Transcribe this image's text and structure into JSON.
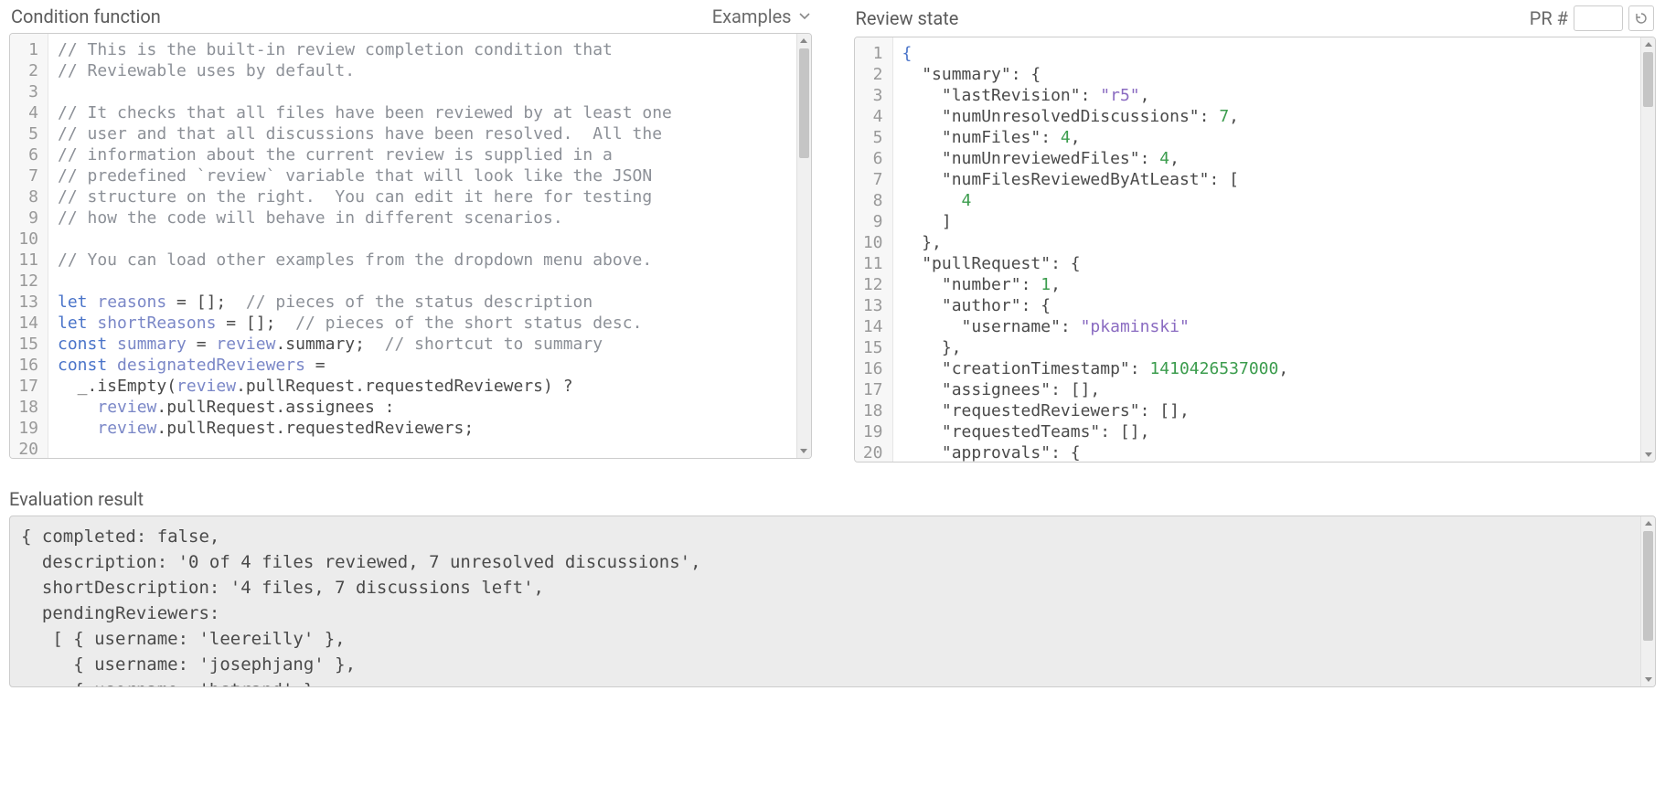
{
  "left": {
    "title": "Condition function",
    "examples_label": "Examples",
    "code_lines": [
      {
        "n": "1",
        "t": "comment",
        "text": "// This is the built-in review completion condition that"
      },
      {
        "n": "2",
        "t": "comment",
        "text": "// Reviewable uses by default."
      },
      {
        "n": "3",
        "t": "blank",
        "text": ""
      },
      {
        "n": "4",
        "t": "comment",
        "text": "// It checks that all files have been reviewed by at least one"
      },
      {
        "n": "5",
        "t": "comment",
        "text": "// user and that all discussions have been resolved.  All the"
      },
      {
        "n": "6",
        "t": "comment",
        "text": "// information about the current review is supplied in a"
      },
      {
        "n": "7",
        "t": "comment",
        "text": "// predefined `review` variable that will look like the JSON"
      },
      {
        "n": "8",
        "t": "comment",
        "text": "// structure on the right.  You can edit it here for testing"
      },
      {
        "n": "9",
        "t": "comment",
        "text": "// how the code will behave in different scenarios."
      },
      {
        "n": "10",
        "t": "blank",
        "text": ""
      },
      {
        "n": "11",
        "t": "comment",
        "text": "// You can load other examples from the dropdown menu above."
      },
      {
        "n": "12",
        "t": "blank",
        "text": ""
      },
      {
        "n": "13",
        "t": "js",
        "tokens": [
          [
            "kw",
            "let "
          ],
          [
            "vr",
            "reasons"
          ],
          [
            "pun",
            " = [];  "
          ],
          [
            "cm",
            "// pieces of the status description"
          ]
        ]
      },
      {
        "n": "14",
        "t": "js",
        "tokens": [
          [
            "kw",
            "let "
          ],
          [
            "vr",
            "shortReasons"
          ],
          [
            "pun",
            " = [];  "
          ],
          [
            "cm",
            "// pieces of the short status desc."
          ]
        ]
      },
      {
        "n": "15",
        "t": "js",
        "tokens": [
          [
            "kw",
            "const "
          ],
          [
            "vr",
            "summary"
          ],
          [
            "pun",
            " = "
          ],
          [
            "vr",
            "review"
          ],
          [
            "pun",
            ".summary;  "
          ],
          [
            "cm",
            "// shortcut to summary"
          ]
        ]
      },
      {
        "n": "16",
        "t": "js",
        "tokens": [
          [
            "kw",
            "const "
          ],
          [
            "vr",
            "designatedReviewers"
          ],
          [
            "pun",
            " ="
          ]
        ]
      },
      {
        "n": "17",
        "t": "js",
        "tokens": [
          [
            "pun",
            "  _.isEmpty("
          ],
          [
            "vr",
            "review"
          ],
          [
            "pun",
            ".pullRequest.requestedReviewers) ?"
          ]
        ]
      },
      {
        "n": "18",
        "t": "js",
        "tokens": [
          [
            "pun",
            "    "
          ],
          [
            "vr",
            "review"
          ],
          [
            "pun",
            ".pullRequest.assignees :"
          ]
        ]
      },
      {
        "n": "19",
        "t": "js",
        "tokens": [
          [
            "pun",
            "    "
          ],
          [
            "vr",
            "review"
          ],
          [
            "pun",
            ".pullRequest.requestedReviewers;"
          ]
        ]
      },
      {
        "n": "20",
        "t": "blank",
        "text": ""
      }
    ]
  },
  "right": {
    "title": "Review state",
    "pr_label": "PR #",
    "pr_value": "",
    "json_lines": [
      {
        "n": "1",
        "tokens": [
          [
            "brace",
            "{"
          ]
        ]
      },
      {
        "n": "2",
        "tokens": [
          [
            "pun",
            "  "
          ],
          [
            "key",
            "\"summary\""
          ],
          [
            "pun",
            ": {"
          ]
        ]
      },
      {
        "n": "3",
        "tokens": [
          [
            "pun",
            "    "
          ],
          [
            "key",
            "\"lastRevision\""
          ],
          [
            "pun",
            ": "
          ],
          [
            "str",
            "\"r5\""
          ],
          [
            "pun",
            ","
          ]
        ]
      },
      {
        "n": "4",
        "tokens": [
          [
            "pun",
            "    "
          ],
          [
            "key",
            "\"numUnresolvedDiscussions\""
          ],
          [
            "pun",
            ": "
          ],
          [
            "num",
            "7"
          ],
          [
            "pun",
            ","
          ]
        ]
      },
      {
        "n": "5",
        "tokens": [
          [
            "pun",
            "    "
          ],
          [
            "key",
            "\"numFiles\""
          ],
          [
            "pun",
            ": "
          ],
          [
            "num",
            "4"
          ],
          [
            "pun",
            ","
          ]
        ]
      },
      {
        "n": "6",
        "tokens": [
          [
            "pun",
            "    "
          ],
          [
            "key",
            "\"numUnreviewedFiles\""
          ],
          [
            "pun",
            ": "
          ],
          [
            "num",
            "4"
          ],
          [
            "pun",
            ","
          ]
        ]
      },
      {
        "n": "7",
        "tokens": [
          [
            "pun",
            "    "
          ],
          [
            "key",
            "\"numFilesReviewedByAtLeast\""
          ],
          [
            "pun",
            ": ["
          ]
        ]
      },
      {
        "n": "8",
        "tokens": [
          [
            "pun",
            "      "
          ],
          [
            "num",
            "4"
          ]
        ]
      },
      {
        "n": "9",
        "tokens": [
          [
            "pun",
            "    ]"
          ]
        ]
      },
      {
        "n": "10",
        "tokens": [
          [
            "pun",
            "  },"
          ]
        ]
      },
      {
        "n": "11",
        "tokens": [
          [
            "pun",
            "  "
          ],
          [
            "key",
            "\"pullRequest\""
          ],
          [
            "pun",
            ": {"
          ]
        ]
      },
      {
        "n": "12",
        "tokens": [
          [
            "pun",
            "    "
          ],
          [
            "key",
            "\"number\""
          ],
          [
            "pun",
            ": "
          ],
          [
            "num",
            "1"
          ],
          [
            "pun",
            ","
          ]
        ]
      },
      {
        "n": "13",
        "tokens": [
          [
            "pun",
            "    "
          ],
          [
            "key",
            "\"author\""
          ],
          [
            "pun",
            ": {"
          ]
        ]
      },
      {
        "n": "14",
        "tokens": [
          [
            "pun",
            "      "
          ],
          [
            "key",
            "\"username\""
          ],
          [
            "pun",
            ": "
          ],
          [
            "str",
            "\"pkaminski\""
          ]
        ]
      },
      {
        "n": "15",
        "tokens": [
          [
            "pun",
            "    },"
          ]
        ]
      },
      {
        "n": "16",
        "tokens": [
          [
            "pun",
            "    "
          ],
          [
            "key",
            "\"creationTimestamp\""
          ],
          [
            "pun",
            ": "
          ],
          [
            "num",
            "1410426537000"
          ],
          [
            "pun",
            ","
          ]
        ]
      },
      {
        "n": "17",
        "tokens": [
          [
            "pun",
            "    "
          ],
          [
            "key",
            "\"assignees\""
          ],
          [
            "pun",
            ": [],"
          ]
        ]
      },
      {
        "n": "18",
        "tokens": [
          [
            "pun",
            "    "
          ],
          [
            "key",
            "\"requestedReviewers\""
          ],
          [
            "pun",
            ": [],"
          ]
        ]
      },
      {
        "n": "19",
        "tokens": [
          [
            "pun",
            "    "
          ],
          [
            "key",
            "\"requestedTeams\""
          ],
          [
            "pun",
            ": [],"
          ]
        ]
      },
      {
        "n": "20",
        "tokens": [
          [
            "pun",
            "    "
          ],
          [
            "key",
            "\"approvals\""
          ],
          [
            "pun",
            ": {"
          ]
        ]
      }
    ]
  },
  "result": {
    "title": "Evaluation result",
    "text": "{ completed: false,\n  description: '0 of 4 files reviewed, 7 unresolved discussions',\n  shortDescription: '4 files, 7 discussions left',\n  pendingReviewers:\n   [ { username: 'leereilly' },\n     { username: 'josephjang' },\n     { username: 'bstrand' },"
  }
}
